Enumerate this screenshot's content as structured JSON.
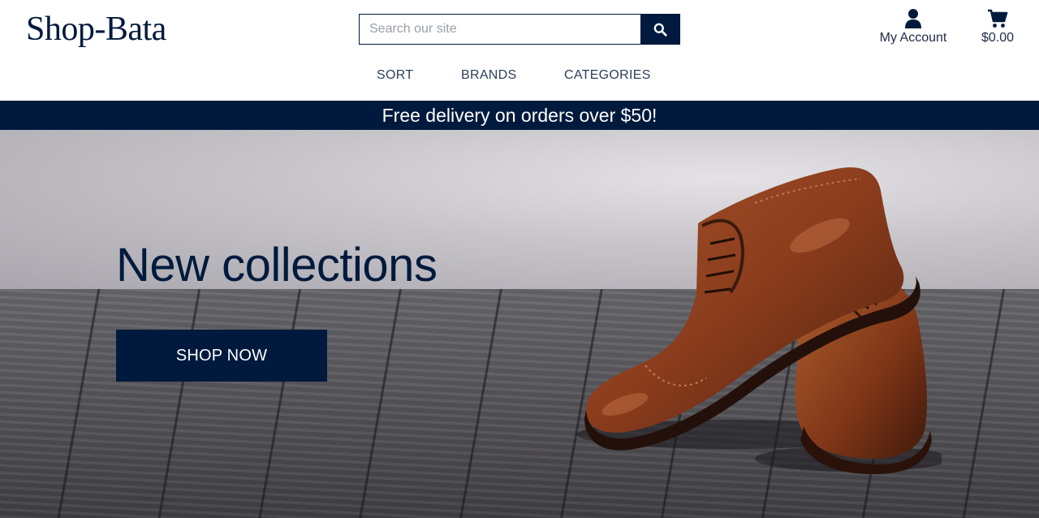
{
  "header": {
    "logo": "Shop-Bata",
    "search": {
      "placeholder": "Search our site",
      "value": ""
    },
    "account_label": "My Account",
    "cart_total": "$0.00"
  },
  "nav": {
    "items": [
      {
        "label": "SORT"
      },
      {
        "label": "BRANDS"
      },
      {
        "label": "CATEGORIES"
      }
    ]
  },
  "promo": {
    "text": "Free delivery on orders over $50!"
  },
  "hero": {
    "title": "New collections",
    "cta_label": "SHOP NOW"
  },
  "icons": {
    "search": "search-icon",
    "account": "user-icon",
    "cart": "cart-icon"
  },
  "colors": {
    "brand_navy": "#001a3d",
    "promo_text": "#ffffff",
    "shoe_leather": "#8a3c1c"
  }
}
